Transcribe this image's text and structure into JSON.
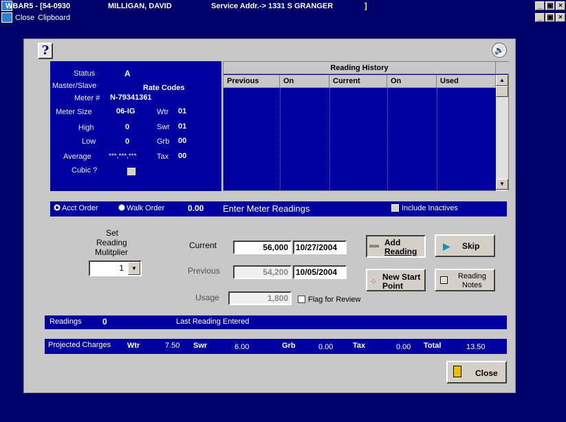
{
  "window": {
    "title_app": "WBAR5 - [54-0930",
    "title_customer": "MILLIGAN, DAVID",
    "title_service_addr": "Service Addr.-> 1331 S GRANGER",
    "title_bracket": "]",
    "controls": [
      "_",
      "̅",
      "×"
    ]
  },
  "menu": {
    "items": [
      "Close",
      "Clipboard"
    ]
  },
  "info": {
    "status_label": "Status",
    "status_value": "A",
    "master_slave_label": "Master/Slave",
    "rate_codes_label": "Rate Codes",
    "meter_label": "Meter #",
    "meter_value": "N-79341361",
    "meter_size_label": "Meter Size",
    "meter_size_value": "06-IG",
    "high_label": "High",
    "high_value": "0",
    "low_label": "Low",
    "low_value": "0",
    "average_label": "Average",
    "average_value": "***,***,***",
    "cubic_label": "Cubic ?",
    "rates": [
      {
        "label": "Wtr",
        "value": "01"
      },
      {
        "label": "Swr",
        "value": "01"
      },
      {
        "label": "Grb",
        "value": "00"
      },
      {
        "label": "Tax",
        "value": "00"
      }
    ]
  },
  "history": {
    "title": "Reading History",
    "columns": [
      "Previous",
      "On",
      "Current",
      "On",
      "Used"
    ]
  },
  "order_bar": {
    "acct_order": "Acct Order",
    "walk_order": "Walk Order",
    "amount": "0.00",
    "enter_label": "Enter Meter Readings",
    "include_inactives": "Include Inactives"
  },
  "readings": {
    "set_multiplier_label": [
      "Set",
      "Reading",
      "Mulitplier"
    ],
    "multiplier_value": "1",
    "current_label": "Current",
    "current_value": "56,000",
    "current_date": "10/27/2004",
    "previous_label": "Previous",
    "previous_value": "54,200",
    "previous_date": "10/05/2004",
    "usage_label": "Usage",
    "usage_value": "1,800",
    "flag_label": "Flag for Review"
  },
  "buttons": {
    "add_reading": [
      "Add",
      "Reading"
    ],
    "skip": "Skip",
    "new_start_point": [
      "New Start",
      "Point"
    ],
    "reading_notes": [
      "Reading",
      "Notes"
    ],
    "close": "Close"
  },
  "readings_bar": {
    "readings_label": "Readings",
    "readings_count": "0",
    "last_reading_label": "Last Reading Entered"
  },
  "charges_bar": {
    "label": "Projected Charges",
    "wtr_label": "Wtr",
    "wtr_value": "7.50",
    "swr_label": "Swr",
    "swr_value": "6.00",
    "grb_label": "Grb",
    "grb_value": "0.00",
    "tax_label": "Tax",
    "tax_value": "0.00",
    "total_label": "Total",
    "total_value": "13.50"
  }
}
